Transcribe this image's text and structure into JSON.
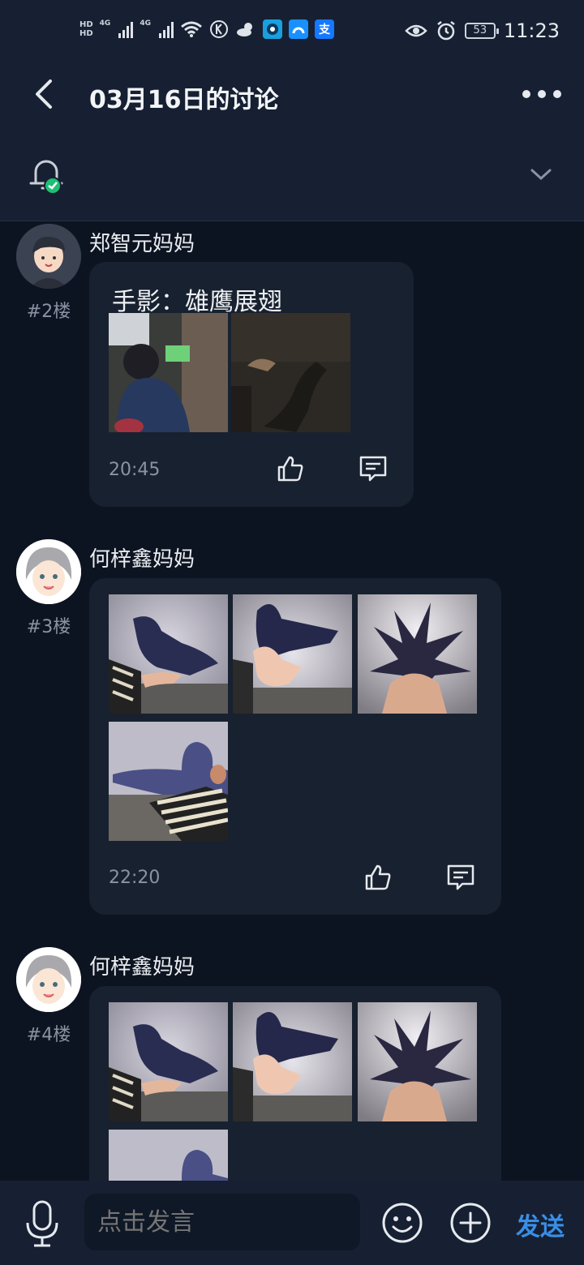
{
  "statusbar": {
    "hd1": "HD",
    "hd2": "HD",
    "net1": "4G",
    "net2": "4G",
    "battery": "53",
    "time": "11:23",
    "alipay_glyph": "支"
  },
  "nav": {
    "title": "03月16日的讨论"
  },
  "posts": [
    {
      "author": "郑智元妈妈",
      "floor": "#2楼",
      "caption": "手影：雄鹰展翅",
      "time": "20:45"
    },
    {
      "author": "何梓鑫妈妈",
      "floor": "#3楼",
      "time": "22:20"
    },
    {
      "author": "何梓鑫妈妈",
      "floor": "#4楼"
    }
  ],
  "composer": {
    "placeholder": "点击发言",
    "send_label": "发送"
  },
  "colors": {
    "background": "#0d1421",
    "header": "#162032",
    "card": "#18212f",
    "accent": "#3a8ee6",
    "muted": "#8a93a3"
  }
}
